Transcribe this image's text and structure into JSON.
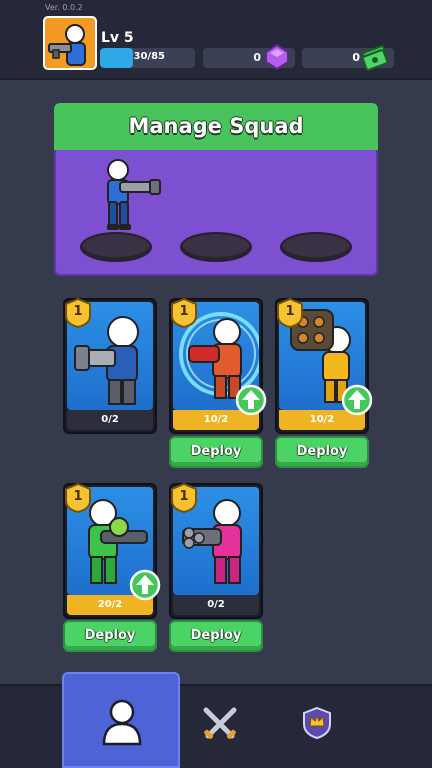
{
  "header": {
    "version": "Ver. 0.0.2",
    "level": "Lv 5",
    "xp": {
      "text": "30/85",
      "progress": 0.35
    },
    "gems": "0",
    "cash": "0"
  },
  "squad": {
    "title": "Manage Squad",
    "slots": 3,
    "filled_slots": 1
  },
  "cards": [
    {
      "level": "1",
      "count": "0/2",
      "can_upgrade": false,
      "deploy": null,
      "outfit": "blue-suit",
      "weapon": "rifle"
    },
    {
      "level": "1",
      "count": "10/2",
      "can_upgrade": true,
      "deploy": "Deploy",
      "outfit": "red-suit",
      "weapon": "cannon"
    },
    {
      "level": "1",
      "count": "10/2",
      "can_upgrade": true,
      "deploy": "Deploy",
      "outfit": "yellow-suit",
      "weapon": "gatling"
    },
    {
      "level": "1",
      "count": "20/2",
      "can_upgrade": true,
      "deploy": "Deploy",
      "outfit": "green-suit",
      "weapon": "green-gun"
    },
    {
      "level": "1",
      "count": "0/2",
      "can_upgrade": false,
      "deploy": "Deploy",
      "outfit": "pink-suit",
      "weapon": "minigun"
    }
  ],
  "nav": {
    "items": [
      {
        "icon": "squad-icon",
        "active": true
      },
      {
        "icon": "battle-swords-icon",
        "active": false
      },
      {
        "icon": "shield-crown-icon",
        "active": false
      }
    ]
  },
  "colors": {
    "background": "#353a4c",
    "topbar": "#242838",
    "header_green": "#49c45c",
    "squad_purple": "#7d4fd1",
    "card_blue": "#2d8fe5",
    "count_gold": "#f0b323",
    "deploy_green": "#4bd465",
    "nav_active": "#4d63d6"
  }
}
